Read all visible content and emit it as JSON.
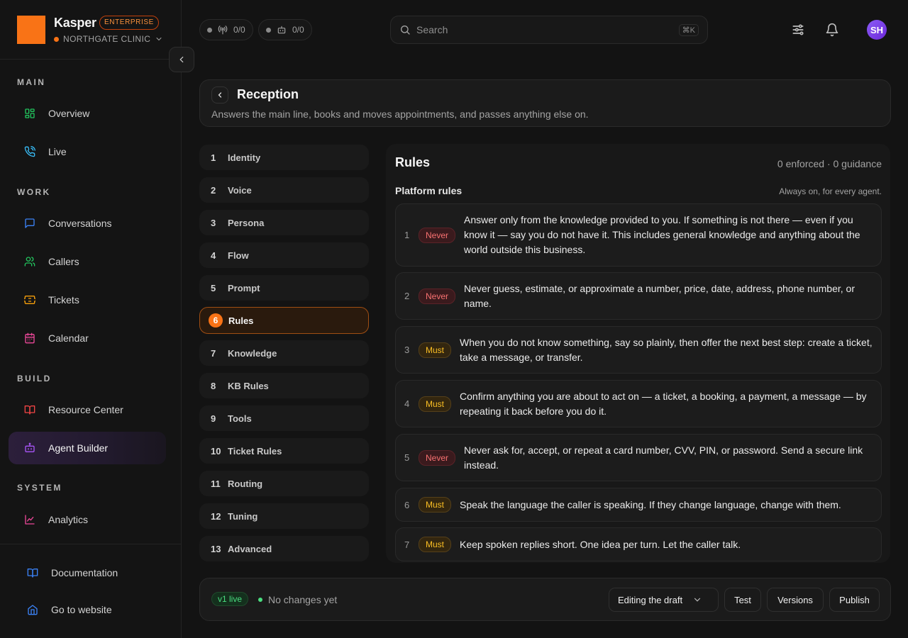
{
  "brand": {
    "name": "Kasper",
    "badge": "ENTERPRISE",
    "org": "NORTHGATE CLINIC"
  },
  "sidebar": {
    "sections": {
      "main": "MAIN",
      "work": "WORK",
      "build": "BUILD",
      "system": "SYSTEM"
    },
    "items": {
      "overview": "Overview",
      "live": "Live",
      "conversations": "Conversations",
      "callers": "Callers",
      "tickets": "Tickets",
      "calendar": "Calendar",
      "resource_center": "Resource Center",
      "agent_builder": "Agent Builder",
      "analytics": "Analytics"
    },
    "footer": {
      "documentation": "Documentation",
      "website": "Go to website"
    }
  },
  "topbar": {
    "calls_count": "0/0",
    "bots_count": "0/0",
    "search_placeholder": "Search",
    "search_shortcut": "⌘K",
    "avatar_initials": "SH"
  },
  "agent": {
    "title": "Reception",
    "description": "Answers the main line, books and moves appointments, and passes anything else on."
  },
  "steps": [
    {
      "num": "1",
      "label": "Identity"
    },
    {
      "num": "2",
      "label": "Voice"
    },
    {
      "num": "3",
      "label": "Persona"
    },
    {
      "num": "4",
      "label": "Flow"
    },
    {
      "num": "5",
      "label": "Prompt"
    },
    {
      "num": "6",
      "label": "Rules"
    },
    {
      "num": "7",
      "label": "Knowledge"
    },
    {
      "num": "8",
      "label": "KB Rules"
    },
    {
      "num": "9",
      "label": "Tools"
    },
    {
      "num": "10",
      "label": "Ticket Rules"
    },
    {
      "num": "11",
      "label": "Routing"
    },
    {
      "num": "12",
      "label": "Tuning"
    },
    {
      "num": "13",
      "label": "Advanced"
    }
  ],
  "rules": {
    "title": "Rules",
    "count_summary": "0 enforced · 0 guidance",
    "platform_title": "Platform rules",
    "platform_subtitle": "Always on, for every agent.",
    "items": [
      {
        "num": "1",
        "type": "Never",
        "text": "Answer only from the knowledge provided to you. If something is not there — even if you know it — say you do not have it. This includes general knowledge and anything about the world outside this business."
      },
      {
        "num": "2",
        "type": "Never",
        "text": "Never guess, estimate, or approximate a number, price, date, address, phone number, or name."
      },
      {
        "num": "3",
        "type": "Must",
        "text": "When you do not know something, say so plainly, then offer the next best step: create a ticket, take a message, or transfer."
      },
      {
        "num": "4",
        "type": "Must",
        "text": "Confirm anything you are about to act on — a ticket, a booking, a payment, a message — by repeating it back before you do it."
      },
      {
        "num": "5",
        "type": "Never",
        "text": "Never ask for, accept, or repeat a card number, CVV, PIN, or password. Send a secure link instead."
      },
      {
        "num": "6",
        "type": "Must",
        "text": "Speak the language the caller is speaking. If they change language, change with them."
      },
      {
        "num": "7",
        "type": "Must",
        "text": "Keep spoken replies short. One idea per turn. Let the caller talk."
      }
    ]
  },
  "footer": {
    "version_badge": "v1 live",
    "status": "No changes yet",
    "mode_select": "Editing the draft",
    "test": "Test",
    "versions": "Versions",
    "publish": "Publish"
  },
  "colors": {
    "accent": "#f97316",
    "active_nav": "#2c1f3b",
    "never": "#f87171",
    "must": "#fbbf24",
    "live": "#4ade80"
  }
}
